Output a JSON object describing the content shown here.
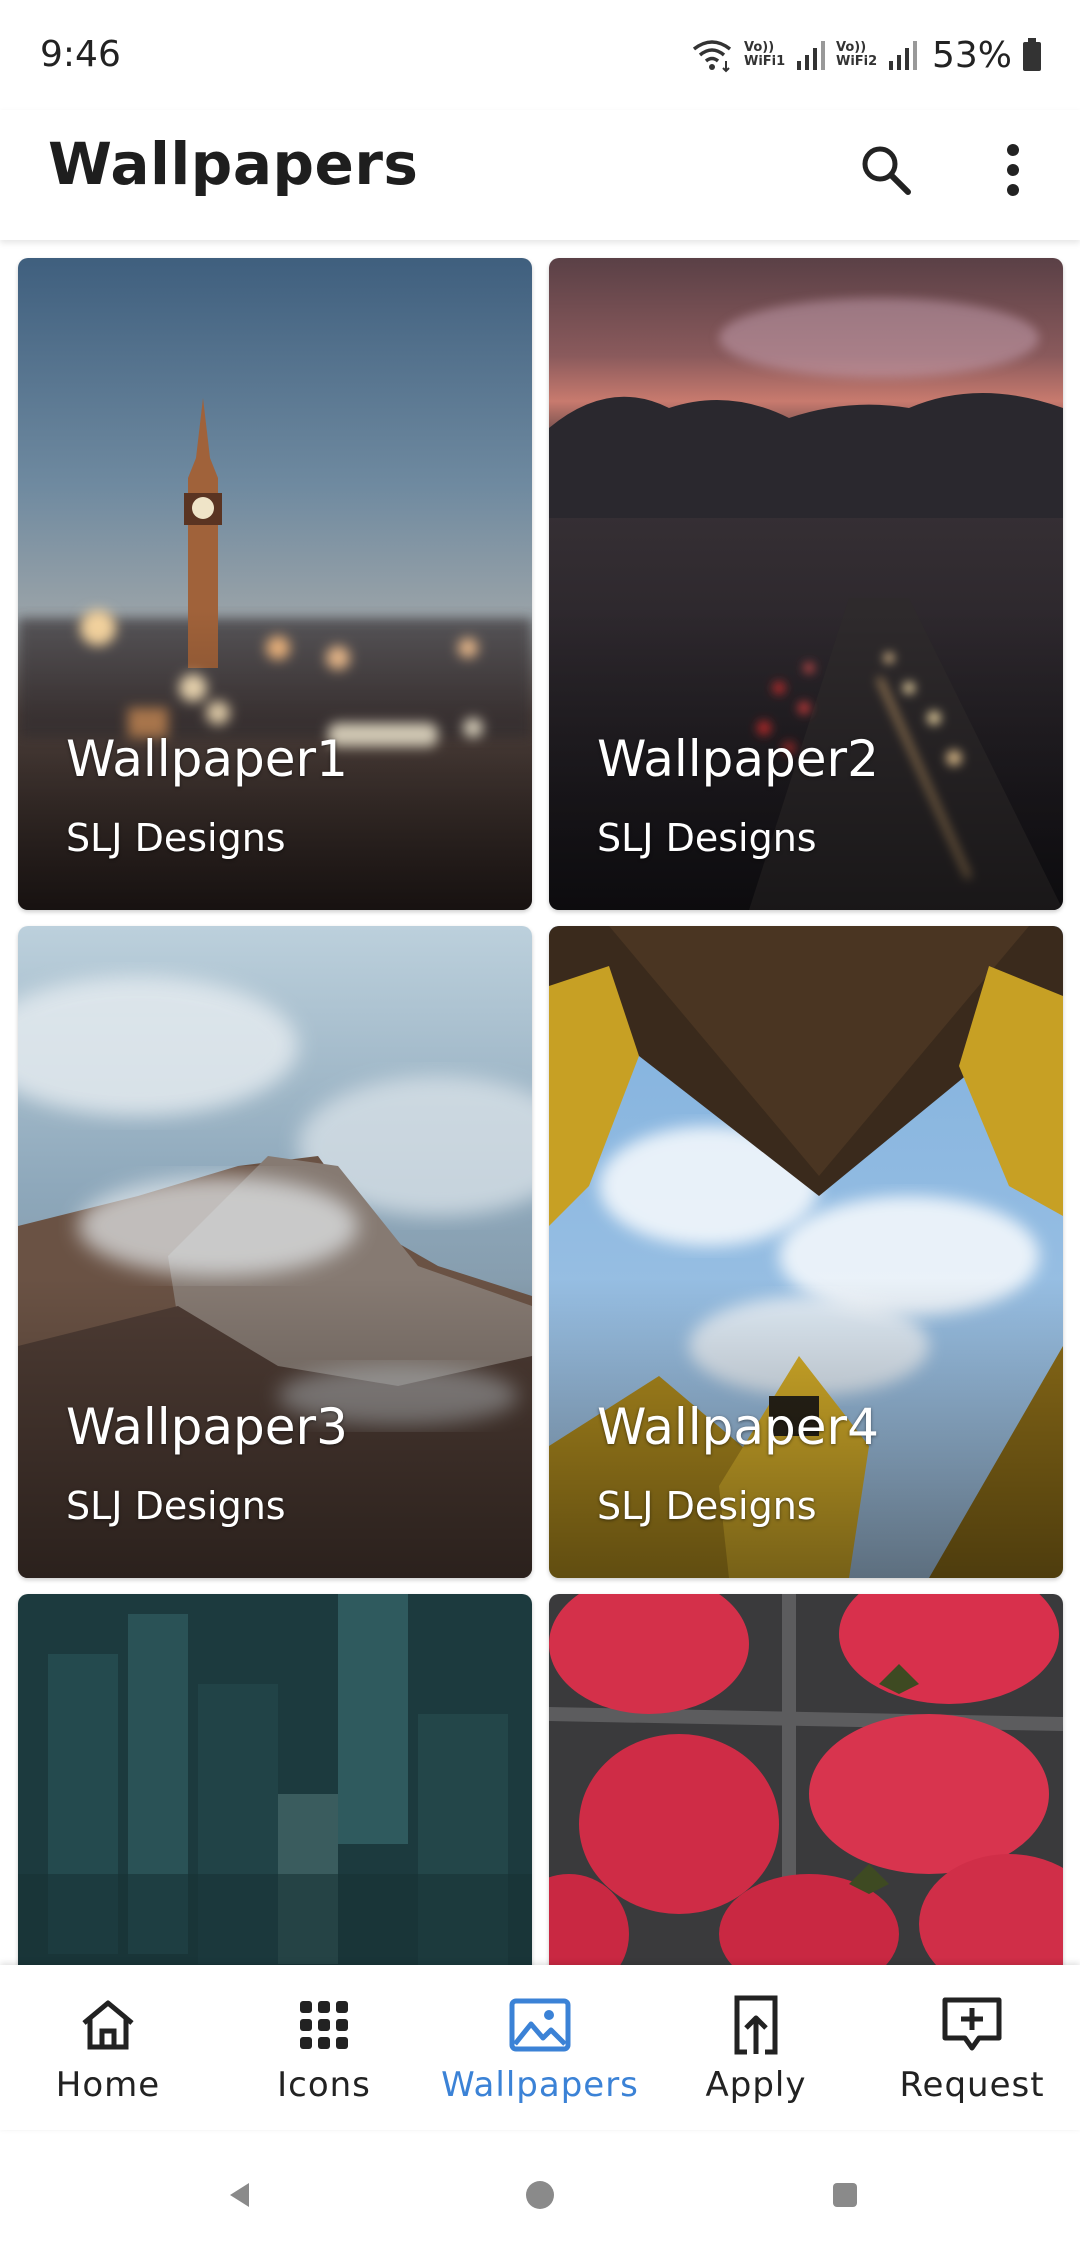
{
  "status_bar": {
    "time": "9:46",
    "sim1_label": "Vo)) WiFi1",
    "sim2_label": "Vo)) WiFi2",
    "battery": "53%",
    "icons": [
      "wifi-icon",
      "volte-wifi1-icon",
      "signal-icon",
      "volte-wifi2-icon",
      "signal-icon",
      "battery-icon"
    ]
  },
  "app_bar": {
    "title": "Wallpapers",
    "actions": [
      "search-icon",
      "more-vert-icon"
    ]
  },
  "wallpapers": [
    {
      "title": "Wallpaper1",
      "author": "SLJ Designs"
    },
    {
      "title": "Wallpaper2",
      "author": "SLJ Designs"
    },
    {
      "title": "Wallpaper3",
      "author": "SLJ Designs"
    },
    {
      "title": "Wallpaper4",
      "author": "SLJ Designs"
    },
    {
      "title": "",
      "author": ""
    },
    {
      "title": "",
      "author": ""
    }
  ],
  "bottom_nav": {
    "items": [
      {
        "label": "Home",
        "icon": "home-icon"
      },
      {
        "label": "Icons",
        "icon": "grid-icon"
      },
      {
        "label": "Wallpapers",
        "icon": "image-icon"
      },
      {
        "label": "Apply",
        "icon": "apply-icon"
      },
      {
        "label": "Request",
        "icon": "add-box-icon"
      }
    ],
    "active": "Wallpapers",
    "active_color": "#3b82d6"
  },
  "system_nav": [
    "back-icon",
    "home-circle-icon",
    "recents-icon"
  ]
}
